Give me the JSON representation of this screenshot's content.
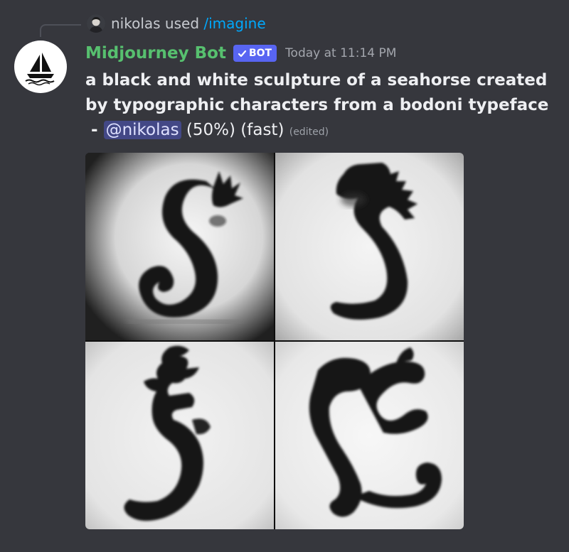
{
  "reply": {
    "username": "nikolas",
    "used_text": " used ",
    "command": "/imagine"
  },
  "message": {
    "author": "Midjourney Bot",
    "bot_badge": "BOT",
    "timestamp": "Today at 11:14 PM",
    "prompt": "a black and white sculpture of a seahorse created by typographic characters from a bodoni typeface",
    "separator": " - ",
    "mention": "@nikolas",
    "progress": "(50%)",
    "speed": "(fast)",
    "edited": "(edited)"
  },
  "icons": {
    "bot_avatar": "sailboat-logo-icon",
    "badge_check": "checkmark-icon",
    "user_avatar": "user-photo-icon"
  },
  "colors": {
    "background": "#36373d",
    "author": "#57c06f",
    "badge": "#5865f2",
    "command": "#00a8fc",
    "mention_bg": "#434886"
  }
}
